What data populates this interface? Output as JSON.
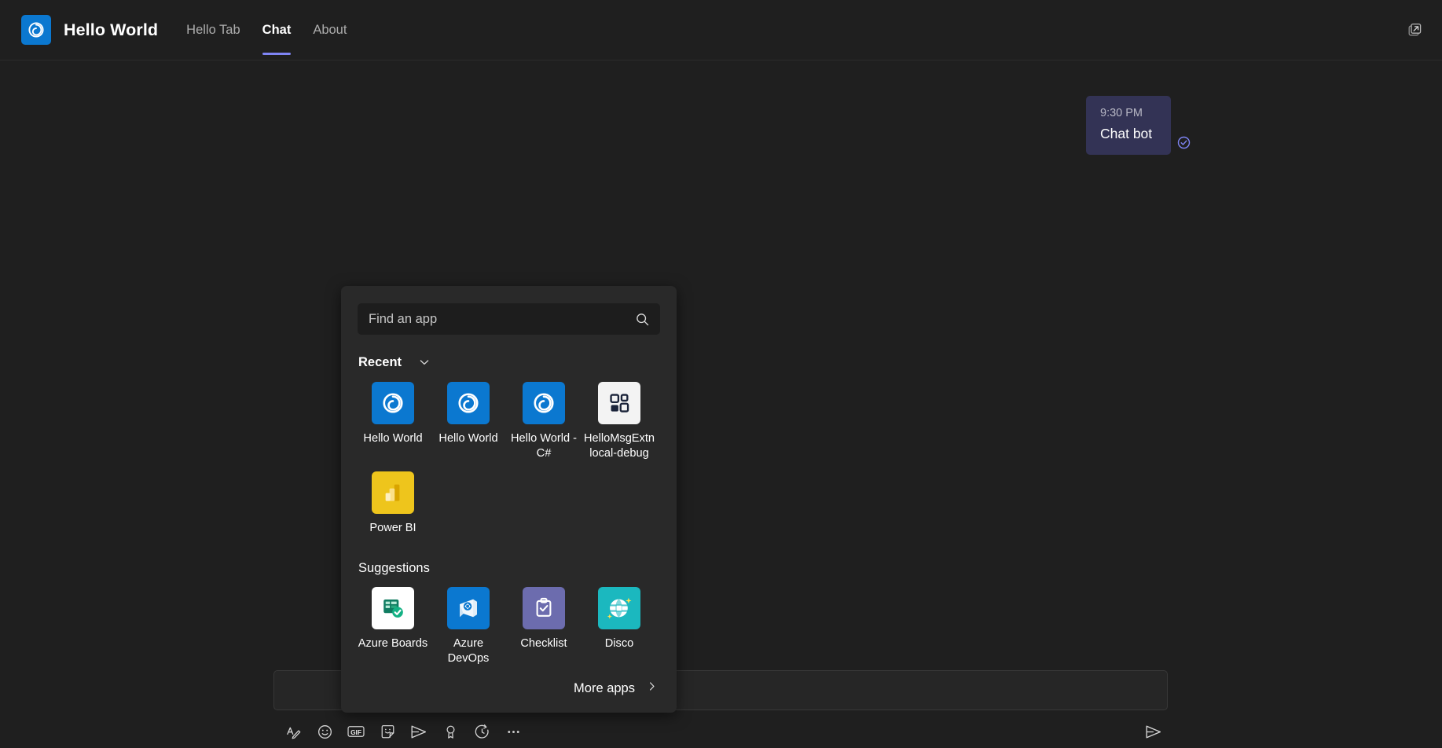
{
  "header": {
    "logo_icon": "hello-world-logo-icon",
    "app_title": "Hello World",
    "tabs": [
      {
        "label": "Hello Tab",
        "active": false
      },
      {
        "label": "Chat",
        "active": true
      },
      {
        "label": "About",
        "active": false
      }
    ],
    "popout_icon": "open-in-new-window-icon",
    "accent_color": "#7f85f5",
    "logo_color": "#0b78d0"
  },
  "conversation": {
    "message": {
      "time": "9:30 PM",
      "text": "Chat bot",
      "status_icon": "sent-check-icon",
      "bubble_color": "#333355"
    }
  },
  "composer": {
    "input_value": "",
    "input_placeholder": "",
    "tools": [
      {
        "name": "format-text-icon",
        "label": "Format"
      },
      {
        "name": "emoji-icon",
        "label": "Emoji"
      },
      {
        "name": "giphy-icon",
        "label": "GIF"
      },
      {
        "name": "sticker-icon",
        "label": "Sticker"
      },
      {
        "name": "messaging-extensions-icon",
        "label": "Apps"
      },
      {
        "name": "praise-icon",
        "label": "Praise"
      },
      {
        "name": "schedule-send-icon",
        "label": "Schedule send"
      },
      {
        "name": "more-options-icon",
        "label": "More options"
      }
    ],
    "send_icon": "send-icon",
    "send_label": "Send"
  },
  "app_flyout": {
    "search": {
      "value": "",
      "placeholder": "Find an app",
      "icon": "search-icon"
    },
    "sections": [
      {
        "title": "Recent",
        "bold": true,
        "collapse_icon": "chevron-down-icon",
        "apps": [
          {
            "label": "Hello World",
            "icon": "hello-world-icon",
            "tile_color": "#0b78d0"
          },
          {
            "label": "Hello World",
            "icon": "hello-world-icon",
            "tile_color": "#0b78d0"
          },
          {
            "label": "Hello World - C#",
            "icon": "hello-world-icon",
            "tile_color": "#0b78d0"
          },
          {
            "label": "HelloMsgExtn local-debug",
            "icon": "app-grid-icon",
            "tile_color": "#f3f3f3"
          },
          {
            "label": "Power BI",
            "icon": "power-bi-icon",
            "tile_color": "#eec51c"
          }
        ]
      },
      {
        "title": "Suggestions",
        "bold": false,
        "apps": [
          {
            "label": "Azure Boards",
            "icon": "azure-boards-icon",
            "tile_color": "#ffffff"
          },
          {
            "label": "Azure DevOps",
            "icon": "azure-devops-icon",
            "tile_color": "#0b78d0"
          },
          {
            "label": "Checklist",
            "icon": "checklist-icon",
            "tile_color": "#6c6cae"
          },
          {
            "label": "Disco",
            "icon": "disco-icon",
            "tile_color": "#1bb8bf"
          }
        ]
      }
    ],
    "footer": {
      "more_apps_label": "More apps",
      "more_apps_icon": "chevron-right-icon"
    }
  }
}
